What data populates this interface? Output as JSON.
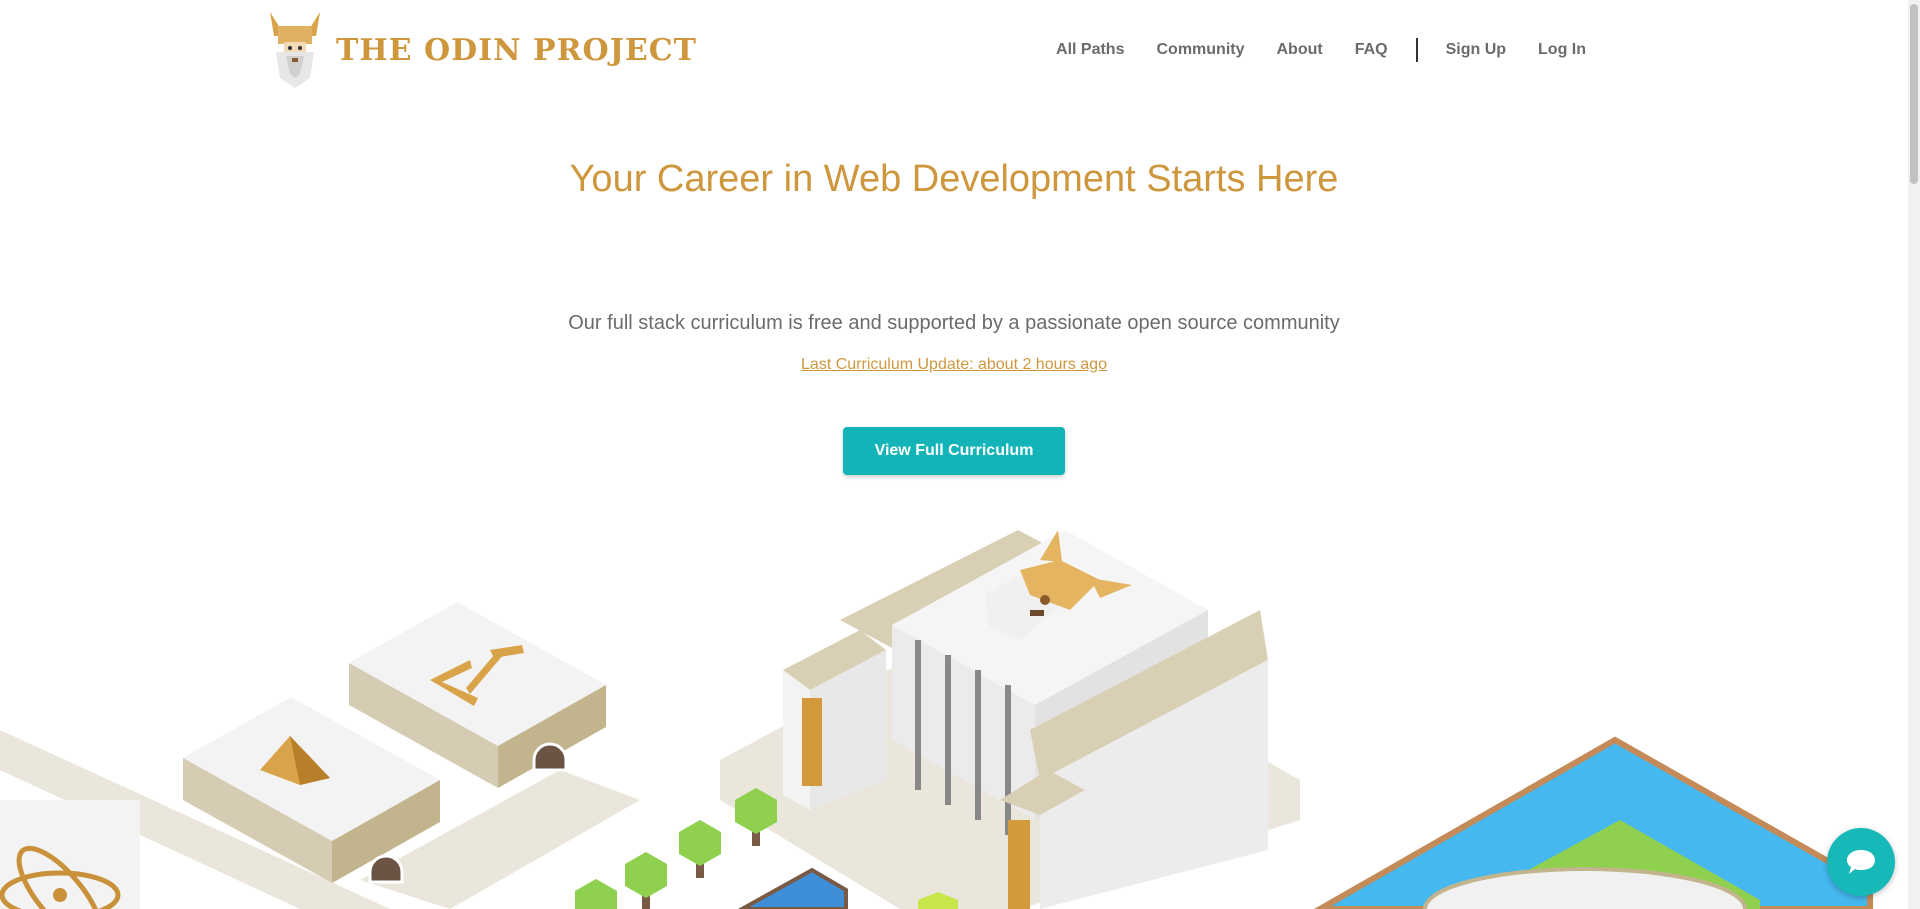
{
  "header": {
    "logo_text": "THE ODIN PROJECT",
    "nav": [
      "All Paths",
      "Community",
      "About",
      "FAQ",
      "Sign Up",
      "Log In"
    ]
  },
  "hero": {
    "title": "Your Career in Web Development Starts Here",
    "subtitle": "Our full stack curriculum is free and supported by a passionate open source community",
    "update_link": "Last Curriculum Update: about 2 hours ago",
    "cta_label": "View Full Curriculum"
  },
  "colors": {
    "brand_gold": "#ce973e",
    "cta_teal": "#13b4b8",
    "text_gray": "#6b6b6b"
  },
  "icons": [
    "odin-logo-icon",
    "code-brackets-icon",
    "gem-icon",
    "atom-icon",
    "odin-head-icon",
    "chat-icon"
  ]
}
